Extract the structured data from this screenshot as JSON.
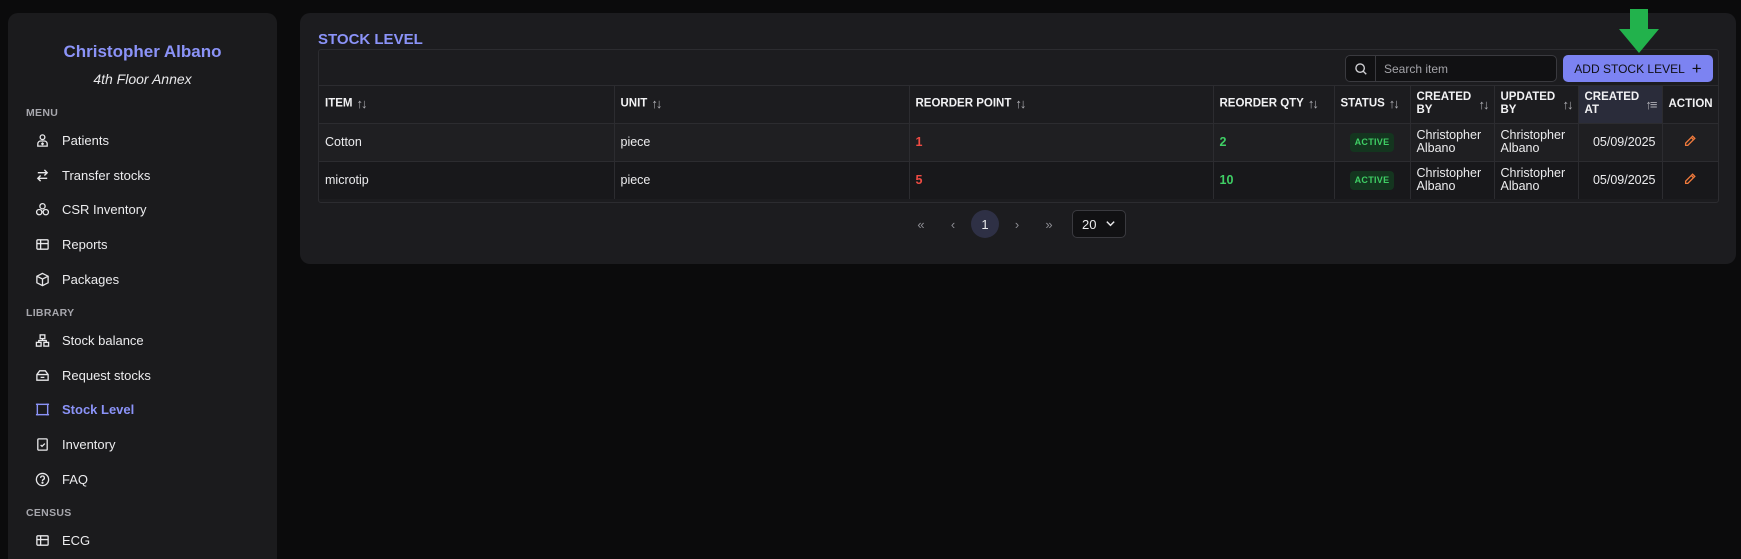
{
  "sidebar": {
    "user_name": "Christopher Albano",
    "location": "4th Floor Annex",
    "sections": {
      "menu": "MENU",
      "library": "LIBRARY",
      "census": "CENSUS"
    },
    "menu_items": [
      {
        "label": "Patients",
        "icon": "patients-icon"
      },
      {
        "label": "Transfer stocks",
        "icon": "transfer-icon"
      },
      {
        "label": "CSR Inventory",
        "icon": "csr-inventory-icon"
      },
      {
        "label": "Reports",
        "icon": "reports-icon"
      },
      {
        "label": "Packages",
        "icon": "package-icon"
      }
    ],
    "library_items": [
      {
        "label": "Stock balance",
        "icon": "stock-balance-icon"
      },
      {
        "label": "Request stocks",
        "icon": "request-stocks-icon"
      },
      {
        "label": "Stock Level",
        "icon": "stock-level-icon",
        "active": true
      },
      {
        "label": "Inventory",
        "icon": "inventory-icon"
      },
      {
        "label": "FAQ",
        "icon": "faq-icon"
      }
    ],
    "census_items": [
      {
        "label": "ECG",
        "icon": "ecg-icon"
      }
    ]
  },
  "main": {
    "title": "STOCK LEVEL",
    "search": {
      "placeholder": "Search item",
      "value": ""
    },
    "add_button": "ADD STOCK LEVEL",
    "columns": {
      "item": "ITEM",
      "unit": "UNIT",
      "reorder_point": "REORDER POINT",
      "reorder_qty": "REORDER QTY",
      "status": "STATUS",
      "created_by": "CREATED BY",
      "updated_by": "UPDATED BY",
      "created_at": "CREATED AT",
      "action": "ACTION"
    },
    "rows": [
      {
        "item": "Cotton",
        "unit": "piece",
        "reorder_point": "1",
        "reorder_qty": "2",
        "status": "ACTIVE",
        "created_by": "Christopher Albano",
        "updated_by": "Christopher Albano",
        "created_at": "05/09/2025"
      },
      {
        "item": "microtip",
        "unit": "piece",
        "reorder_point": "5",
        "reorder_qty": "10",
        "status": "ACTIVE",
        "created_by": "Christopher Albano",
        "updated_by": "Christopher Albano",
        "created_at": "05/09/2025"
      }
    ],
    "pagination": {
      "current_page": "1",
      "page_size": "20"
    }
  },
  "colors": {
    "accent": "#8b93f8",
    "button": "#7c83f2",
    "danger": "#ef4b43",
    "success": "#3fcf65",
    "edit": "#f07a3c",
    "arrow": "#22b24c"
  }
}
